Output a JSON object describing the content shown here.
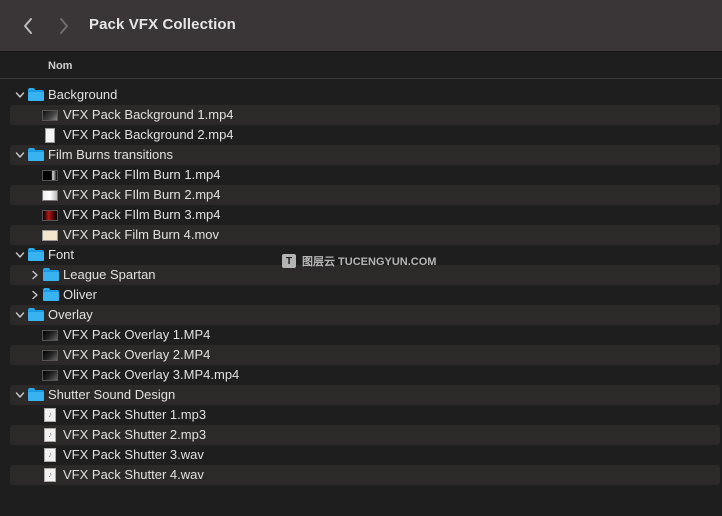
{
  "window": {
    "title": "Pack VFX Collection",
    "back_icon": "chevron-left-icon",
    "forward_icon": "chevron-right-icon"
  },
  "columns": {
    "name": "Nom"
  },
  "rows": [
    {
      "label": "Background",
      "kind": "folder",
      "depth": 0,
      "expanded": true,
      "icon": "folder-icon"
    },
    {
      "label": "VFX Pack Background 1.mp4",
      "kind": "file",
      "depth": 1,
      "icon": "video-thumbnail-dark"
    },
    {
      "label": "VFX Pack Background 2.mp4",
      "kind": "file",
      "depth": 1,
      "icon": "video-thumbnail-white"
    },
    {
      "label": "Film Burns transitions",
      "kind": "folder",
      "depth": 0,
      "expanded": true,
      "icon": "folder-icon"
    },
    {
      "label": "VFX Pack FIlm Burn 1.mp4",
      "kind": "file",
      "depth": 1,
      "icon": "video-thumbnail-burn-1"
    },
    {
      "label": "VFX Pack FIlm Burn 2.mp4",
      "kind": "file",
      "depth": 1,
      "icon": "video-thumbnail-burn-2"
    },
    {
      "label": "VFX Pack FIlm Burn 3.mp4",
      "kind": "file",
      "depth": 1,
      "icon": "video-thumbnail-burn-3"
    },
    {
      "label": "VFX Pack Film Burn 4.mov",
      "kind": "file",
      "depth": 1,
      "icon": "video-thumbnail-burn-4"
    },
    {
      "label": "Font",
      "kind": "folder",
      "depth": 0,
      "expanded": true,
      "icon": "folder-icon"
    },
    {
      "label": "League Spartan",
      "kind": "folder",
      "depth": 1,
      "expanded": false,
      "icon": "folder-icon"
    },
    {
      "label": "Oliver",
      "kind": "folder",
      "depth": 1,
      "expanded": false,
      "icon": "folder-icon"
    },
    {
      "label": "Overlay",
      "kind": "folder",
      "depth": 0,
      "expanded": true,
      "icon": "folder-icon"
    },
    {
      "label": "VFX Pack Overlay 1.MP4",
      "kind": "file",
      "depth": 1,
      "icon": "video-thumbnail-overlay"
    },
    {
      "label": "VFX Pack Overlay 2.MP4",
      "kind": "file",
      "depth": 1,
      "icon": "video-thumbnail-overlay"
    },
    {
      "label": "VFX Pack Overlay 3.MP4.mp4",
      "kind": "file",
      "depth": 1,
      "icon": "video-thumbnail-overlay"
    },
    {
      "label": "Shutter Sound Design",
      "kind": "folder",
      "depth": 0,
      "expanded": true,
      "icon": "folder-icon"
    },
    {
      "label": "VFX Pack Shutter 1.mp3",
      "kind": "file",
      "depth": 1,
      "icon": "audio-file-icon"
    },
    {
      "label": "VFX Pack Shutter 2.mp3",
      "kind": "file",
      "depth": 1,
      "icon": "audio-file-icon"
    },
    {
      "label": "VFX Pack Shutter 3.wav",
      "kind": "file",
      "depth": 1,
      "icon": "audio-file-icon"
    },
    {
      "label": "VFX Pack Shutter 4.wav",
      "kind": "file",
      "depth": 1,
      "icon": "audio-file-icon"
    }
  ],
  "watermark": {
    "logo": "T",
    "text": "图层云  TUCENGYUN.COM"
  },
  "colors": {
    "toolbar_bg": "#3a3637",
    "content_bg": "#1e1e1e",
    "stripe_bg": "#2c2929",
    "folder_blue": "#38b3f0"
  }
}
